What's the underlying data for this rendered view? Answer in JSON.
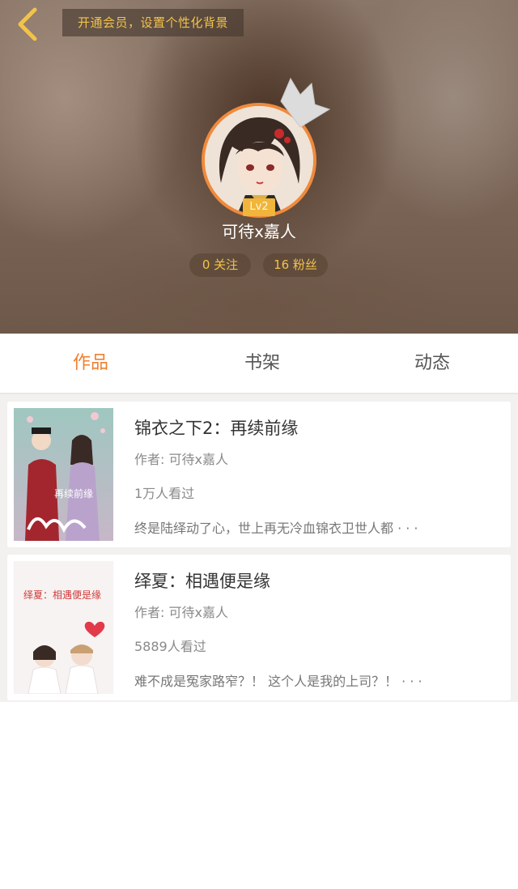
{
  "header": {
    "vip_banner": "开通会员，设置个性化背景",
    "level": "Lv2",
    "username": "可待x嘉人",
    "following": "0 关注",
    "fans": "16 粉丝",
    "icons": {
      "back": "chevron-left-icon",
      "crown": "crown-icon"
    }
  },
  "tabs": [
    {
      "label": "作品",
      "active": true
    },
    {
      "label": "书架",
      "active": false
    },
    {
      "label": "动态",
      "active": false
    }
  ],
  "works": [
    {
      "title": "锦衣之下2：再续前缘",
      "author": "作者: 可待x嘉人",
      "views": "1万人看过",
      "description": "终是陆绎动了心，世上再无冷血锦衣卫世人都 · · ·",
      "cover_text": "再续前缘"
    },
    {
      "title": "绎夏：相遇便是缘",
      "author": "作者: 可待x嘉人",
      "views": "5889人看过",
      "description": "难不成是冤家路窄？！ 这个人是我的上司？！ · · ·",
      "cover_text": "绎夏：相遇便是缘"
    }
  ],
  "colors": {
    "accent": "#f07f2f",
    "gold": "#f2c34a",
    "avatar_ring": "#f08a3c"
  }
}
